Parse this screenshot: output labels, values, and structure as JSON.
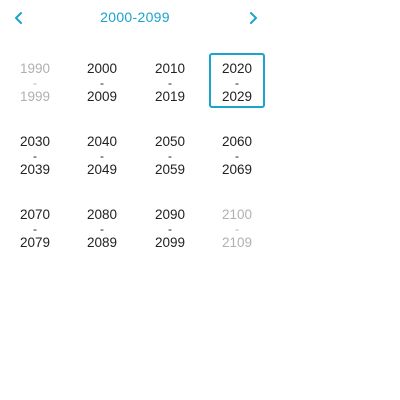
{
  "header": {
    "title": "2000-2099",
    "prev_icon": "chevron-left-icon",
    "next_icon": "chevron-right-icon",
    "accent_color": "#1aa3cc"
  },
  "decades": [
    [
      {
        "start": "1990",
        "dash": "-",
        "end": "1999",
        "muted": true,
        "selected": false
      },
      {
        "start": "2000",
        "dash": "-",
        "end": "2009",
        "muted": false,
        "selected": false
      },
      {
        "start": "2010",
        "dash": "-",
        "end": "2019",
        "muted": false,
        "selected": false
      },
      {
        "start": "2020",
        "dash": "-",
        "end": "2029",
        "muted": false,
        "selected": true
      }
    ],
    [
      {
        "start": "2030",
        "dash": "-",
        "end": "2039",
        "muted": false,
        "selected": false
      },
      {
        "start": "2040",
        "dash": "-",
        "end": "2049",
        "muted": false,
        "selected": false
      },
      {
        "start": "2050",
        "dash": "-",
        "end": "2059",
        "muted": false,
        "selected": false
      },
      {
        "start": "2060",
        "dash": "-",
        "end": "2069",
        "muted": false,
        "selected": false
      }
    ],
    [
      {
        "start": "2070",
        "dash": "-",
        "end": "2079",
        "muted": false,
        "selected": false
      },
      {
        "start": "2080",
        "dash": "-",
        "end": "2089",
        "muted": false,
        "selected": false
      },
      {
        "start": "2090",
        "dash": "-",
        "end": "2099",
        "muted": false,
        "selected": false
      },
      {
        "start": "2100",
        "dash": "-",
        "end": "2109",
        "muted": true,
        "selected": false
      }
    ]
  ]
}
